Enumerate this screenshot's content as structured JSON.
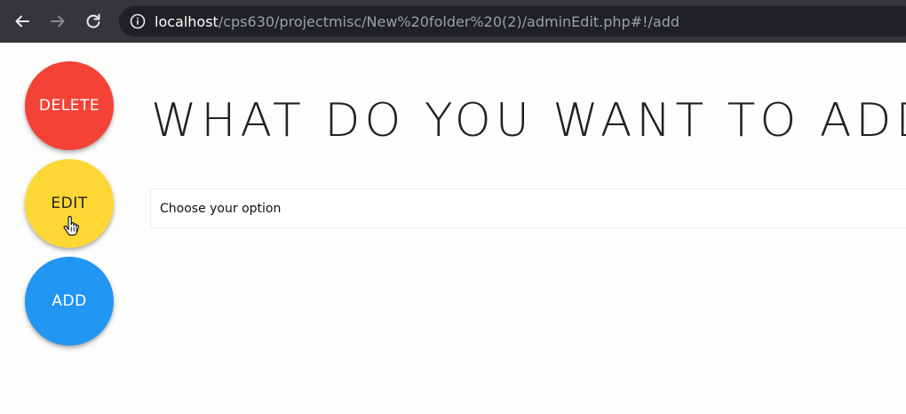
{
  "browser": {
    "url_host": "localhost",
    "url_path": "/cps630/projectmisc/New%20folder%20(2)/adminEdit.php#!/add"
  },
  "actions": {
    "delete_label": "DELETE",
    "edit_label": "EDIT",
    "add_label": "ADD"
  },
  "main": {
    "heading": "WHAT DO YOU WANT TO ADD",
    "select_placeholder": "Choose your option"
  },
  "colors": {
    "delete": "#f44336",
    "edit": "#fdd835",
    "add": "#2196f3",
    "browser_chrome": "#35363a"
  }
}
